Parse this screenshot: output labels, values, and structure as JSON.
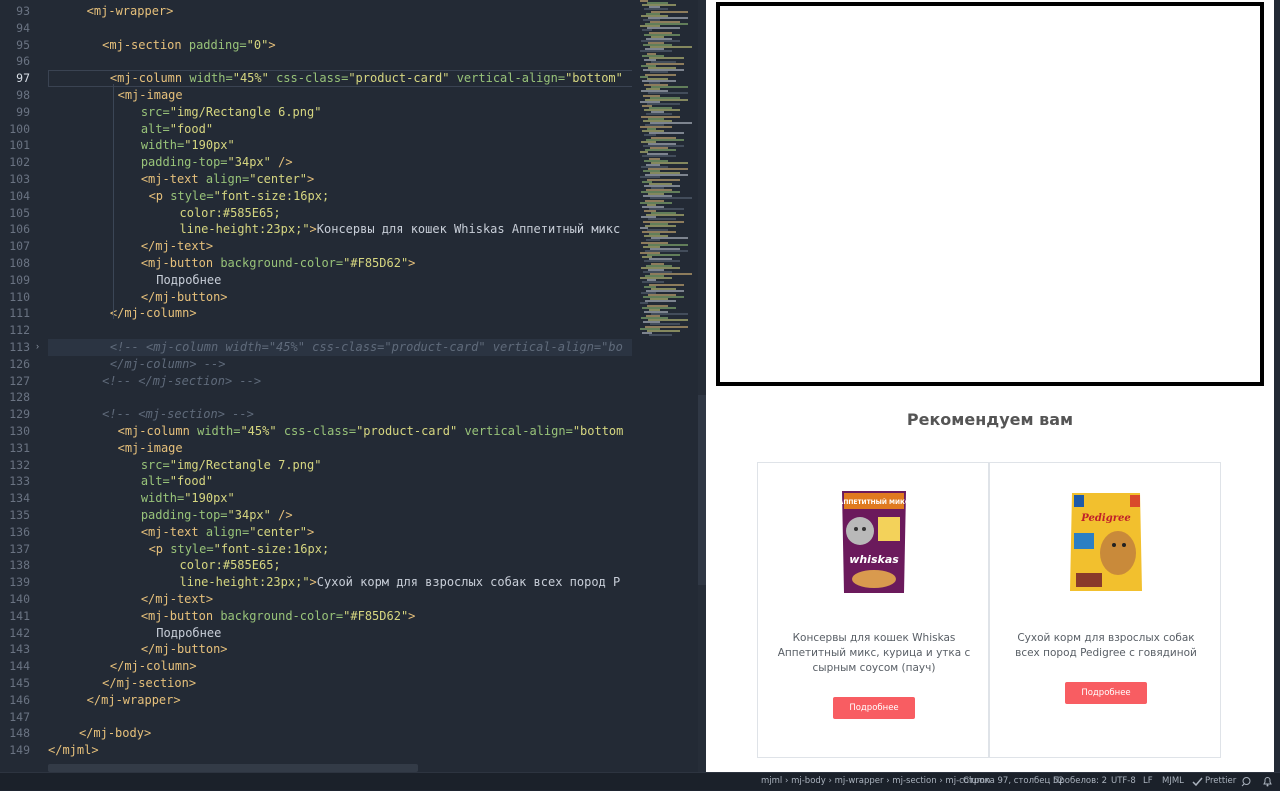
{
  "editor": {
    "active_line": 97,
    "lines": [
      {
        "n": 93,
        "indent": 5,
        "parts": [
          [
            "tag",
            "<mj-wrapper>"
          ]
        ]
      },
      {
        "n": 94,
        "indent": 0,
        "parts": []
      },
      {
        "n": 95,
        "indent": 7,
        "parts": [
          [
            "tag",
            "<mj-section "
          ],
          [
            "attr",
            "padding="
          ],
          [
            "str",
            "\"0\""
          ],
          [
            "tag",
            ">"
          ]
        ]
      },
      {
        "n": 96,
        "indent": 0,
        "parts": []
      },
      {
        "n": 97,
        "indent": 8,
        "parts": [
          [
            "tag",
            "<mj-column "
          ],
          [
            "attr",
            "width="
          ],
          [
            "str",
            "\"45%\" "
          ],
          [
            "attr",
            "css-class="
          ],
          [
            "str",
            "\"product-card\" "
          ],
          [
            "attr",
            "vertical-align="
          ],
          [
            "str",
            "\"bottom\""
          ]
        ]
      },
      {
        "n": 98,
        "indent": 9,
        "parts": [
          [
            "tag",
            "<mj-image"
          ]
        ]
      },
      {
        "n": 99,
        "indent": 12,
        "parts": [
          [
            "attr",
            "src="
          ],
          [
            "str",
            "\"img/Rectangle 6.png\""
          ]
        ]
      },
      {
        "n": 100,
        "indent": 12,
        "parts": [
          [
            "attr",
            "alt="
          ],
          [
            "str",
            "\"food\""
          ]
        ]
      },
      {
        "n": 101,
        "indent": 12,
        "parts": [
          [
            "attr",
            "width="
          ],
          [
            "str",
            "\"190px\""
          ]
        ]
      },
      {
        "n": 102,
        "indent": 12,
        "parts": [
          [
            "attr",
            "padding-top="
          ],
          [
            "str",
            "\"34px\" "
          ],
          [
            "tag",
            "/>"
          ]
        ]
      },
      {
        "n": 103,
        "indent": 12,
        "parts": [
          [
            "tag",
            "<mj-text "
          ],
          [
            "attr",
            "align="
          ],
          [
            "str",
            "\"center\""
          ],
          [
            "tag",
            ">"
          ]
        ]
      },
      {
        "n": 104,
        "indent": 13,
        "parts": [
          [
            "tag",
            "<p "
          ],
          [
            "attr",
            "style="
          ],
          [
            "str",
            "\"font-size:16px;"
          ]
        ]
      },
      {
        "n": 105,
        "indent": 17,
        "parts": [
          [
            "str",
            "color:#585E65;"
          ]
        ]
      },
      {
        "n": 106,
        "indent": 17,
        "parts": [
          [
            "str",
            "line-height:23px;\""
          ],
          [
            "tag",
            ">"
          ],
          [
            "txt",
            "Консервы для кошек Whiskas Аппетитный микс"
          ]
        ]
      },
      {
        "n": 107,
        "indent": 12,
        "parts": [
          [
            "tag",
            "</mj-text>"
          ]
        ]
      },
      {
        "n": 108,
        "indent": 12,
        "parts": [
          [
            "tag",
            "<mj-button "
          ],
          [
            "attr",
            "background-color="
          ],
          [
            "str",
            "\"#F85D62\""
          ],
          [
            "tag",
            ">"
          ]
        ]
      },
      {
        "n": 109,
        "indent": 14,
        "parts": [
          [
            "txt",
            "Подробнее"
          ]
        ]
      },
      {
        "n": 110,
        "indent": 12,
        "parts": [
          [
            "tag",
            "</mj-button>"
          ]
        ]
      },
      {
        "n": 111,
        "indent": 8,
        "parts": [
          [
            "tag",
            "</mj-column>"
          ]
        ]
      },
      {
        "n": 112,
        "indent": 0,
        "parts": []
      },
      {
        "n": 113,
        "indent": 8,
        "parts": [
          [
            "cmt",
            "<!-- <mj-column width=\"45%\" css-class=\"product-card\" vertical-align=\"bo"
          ]
        ]
      },
      {
        "n": 126,
        "indent": 8,
        "parts": [
          [
            "cmt",
            "</mj-column> -->"
          ]
        ]
      },
      {
        "n": 127,
        "indent": 7,
        "parts": [
          [
            "cmt",
            "<!-- </mj-section> -->"
          ]
        ]
      },
      {
        "n": 128,
        "indent": 0,
        "parts": []
      },
      {
        "n": 129,
        "indent": 7,
        "parts": [
          [
            "cmt",
            "<!-- <mj-section> -->"
          ]
        ]
      },
      {
        "n": 130,
        "indent": 9,
        "parts": [
          [
            "tag",
            "<mj-column "
          ],
          [
            "attr",
            "width="
          ],
          [
            "str",
            "\"45%\" "
          ],
          [
            "attr",
            "css-class="
          ],
          [
            "str",
            "\"product-card\" "
          ],
          [
            "attr",
            "vertical-align="
          ],
          [
            "str",
            "\"bottom"
          ]
        ]
      },
      {
        "n": 131,
        "indent": 9,
        "parts": [
          [
            "tag",
            "<mj-image"
          ]
        ]
      },
      {
        "n": 132,
        "indent": 12,
        "parts": [
          [
            "attr",
            "src="
          ],
          [
            "str",
            "\"img/Rectangle 7.png\""
          ]
        ]
      },
      {
        "n": 133,
        "indent": 12,
        "parts": [
          [
            "attr",
            "alt="
          ],
          [
            "str",
            "\"food\""
          ]
        ]
      },
      {
        "n": 134,
        "indent": 12,
        "parts": [
          [
            "attr",
            "width="
          ],
          [
            "str",
            "\"190px\""
          ]
        ]
      },
      {
        "n": 135,
        "indent": 12,
        "parts": [
          [
            "attr",
            "padding-top="
          ],
          [
            "str",
            "\"34px\" "
          ],
          [
            "tag",
            "/>"
          ]
        ]
      },
      {
        "n": 136,
        "indent": 12,
        "parts": [
          [
            "tag",
            "<mj-text "
          ],
          [
            "attr",
            "align="
          ],
          [
            "str",
            "\"center\""
          ],
          [
            "tag",
            ">"
          ]
        ]
      },
      {
        "n": 137,
        "indent": 13,
        "parts": [
          [
            "tag",
            "<p "
          ],
          [
            "attr",
            "style="
          ],
          [
            "str",
            "\"font-size:16px;"
          ]
        ]
      },
      {
        "n": 138,
        "indent": 17,
        "parts": [
          [
            "str",
            "color:#585E65;"
          ]
        ]
      },
      {
        "n": 139,
        "indent": 17,
        "parts": [
          [
            "str",
            "line-height:23px;\""
          ],
          [
            "tag",
            ">"
          ],
          [
            "txt",
            "Сухой корм для взрослых собак всех пород P"
          ]
        ]
      },
      {
        "n": 140,
        "indent": 12,
        "parts": [
          [
            "tag",
            "</mj-text>"
          ]
        ]
      },
      {
        "n": 141,
        "indent": 12,
        "parts": [
          [
            "tag",
            "<mj-button "
          ],
          [
            "attr",
            "background-color="
          ],
          [
            "str",
            "\"#F85D62\""
          ],
          [
            "tag",
            ">"
          ]
        ]
      },
      {
        "n": 142,
        "indent": 14,
        "parts": [
          [
            "txt",
            "Подробнее"
          ]
        ]
      },
      {
        "n": 143,
        "indent": 12,
        "parts": [
          [
            "tag",
            "</mj-button>"
          ]
        ]
      },
      {
        "n": 144,
        "indent": 8,
        "parts": [
          [
            "tag",
            "</mj-column>"
          ]
        ]
      },
      {
        "n": 145,
        "indent": 7,
        "parts": [
          [
            "tag",
            "</mj-section>"
          ]
        ]
      },
      {
        "n": 146,
        "indent": 5,
        "parts": [
          [
            "tag",
            "</mj-wrapper>"
          ]
        ]
      },
      {
        "n": 147,
        "indent": 0,
        "parts": []
      },
      {
        "n": 148,
        "indent": 4,
        "parts": [
          [
            "tag",
            "</mj-body>"
          ]
        ]
      },
      {
        "n": 149,
        "indent": 0,
        "parts": [
          [
            "tag",
            "</mjml>"
          ]
        ]
      }
    ]
  },
  "preview": {
    "section_title": "Рекомендуем вам",
    "cards": [
      {
        "product": "Консервы для кошек Whiskas Аппетитный микс, курица и утка с сырным соусом (пауч)",
        "button": "Подробнее",
        "image_brand": "whiskas",
        "image_label": "АППЕТИТНЫЙ МИКС"
      },
      {
        "product": "Сухой корм для взрослых собак всех пород Pedigree с говядиной",
        "button": "Подробнее",
        "image_brand": "Pedigree",
        "image_label": ""
      }
    ]
  },
  "statusbar": {
    "breadcrumb": "mjml › mj-body › mj-wrapper › mj-section › mj-column",
    "cursor": "Строка 97, столбец 52",
    "spaces": "Пробелов: 2",
    "encoding": "UTF-8",
    "eol": "LF",
    "language": "MJML",
    "formatter": "Prettier"
  },
  "colors": {
    "editor_bg": "#232a35",
    "tag": "#e6c07b",
    "attr": "#98c379",
    "string": "#d6d680",
    "button": "#F85D62",
    "product_text": "#585E65"
  }
}
